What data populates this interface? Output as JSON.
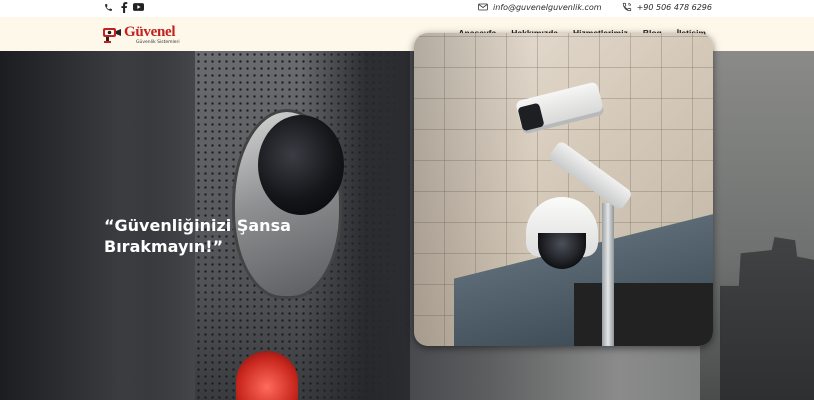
{
  "topbar": {
    "social": [
      {
        "icon": "phone-icon"
      },
      {
        "icon": "facebook-icon"
      },
      {
        "icon": "youtube-icon"
      }
    ],
    "email": "info@guvenelguvenlik.com",
    "phone": "+90 506 478 6296"
  },
  "header": {
    "logo_brand": "Güvenel",
    "logo_tagline": "Güvenlik Sistemleri",
    "nav": [
      "Anasayfa",
      "Hakkımızda",
      "Hizmetlerimiz",
      "Blog",
      "İletişim"
    ]
  },
  "hero": {
    "headline_line1": "“Güvenliğinizi Şansa",
    "headline_line2": "Bırakmayın!”"
  },
  "colors": {
    "brand_red": "#c4201e",
    "header_bg": "#fdf8e9"
  }
}
